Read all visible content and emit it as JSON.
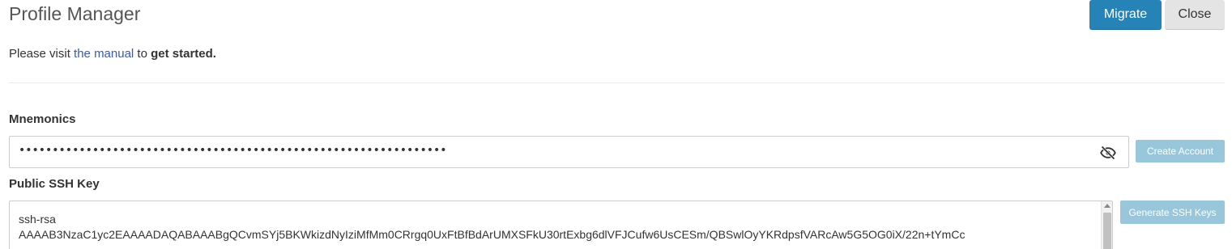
{
  "header": {
    "title": "Profile Manager",
    "migrate_label": "Migrate",
    "close_label": "Close"
  },
  "intro": {
    "prefix": "Please visit ",
    "link": "the manual",
    "middle": " to ",
    "bold": "get started."
  },
  "mnemonics": {
    "label": "Mnemonics",
    "masked_value": "••••••••••••••••••••••••••••••••••••••••••••••••••••••••••••••••",
    "create_label": "Create Account",
    "visibility_icon": "eye-slash-icon"
  },
  "ssh": {
    "label": "Public SSH Key",
    "value": "ssh-rsa\nAAAAB3NzaC1yc2EAAAADAQABAAABgQCvmSYj5BKWkizdNyIziMfMm0CRrgq0UxFtBfBdArUMXSFkU30rtExbg6dlVFJCufw6UsCESm/QBSwlOyYKRdpsfVARcAw5G5OG0iX/22n+tYmCc",
    "generate_label": "Generate SSH Keys"
  },
  "colors": {
    "primary": "#2583b8",
    "secondary": "#e4e4e4",
    "disabled_button": "#98c6da",
    "link": "#3a5aa8"
  }
}
